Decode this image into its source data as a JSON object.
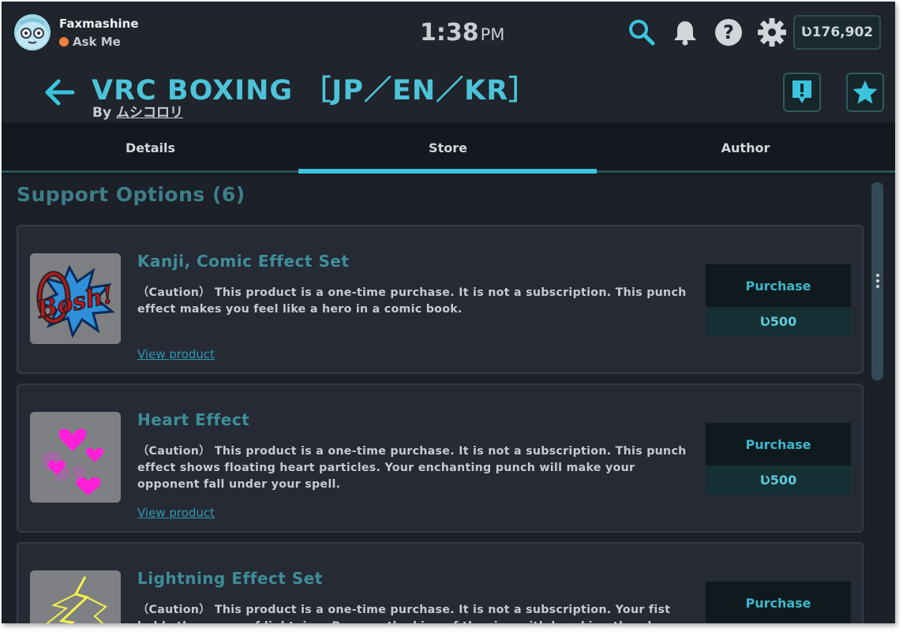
{
  "user": {
    "name": "Faxmashine",
    "status": "Ask Me"
  },
  "clock": {
    "time": "1:38",
    "ampm": "PM"
  },
  "balance": "Ʋ176,902",
  "world": {
    "title": "VRC BOXING ［JP／EN／KR］",
    "by": "By",
    "author": "ムシコロリ"
  },
  "tabs": [
    "Details",
    "Store",
    "Author"
  ],
  "active_tab": "Store",
  "section_title": "Support Options (6)",
  "products": [
    {
      "name": "Kanji, Comic Effect Set",
      "description": "（Caution） This product is a one-time purchase. It is not a subscription. This punch effect makes you feel like a hero in a comic book.",
      "thumb_text": "Bosh!",
      "link": "View product",
      "button": "Purchase",
      "price": "Ʋ500"
    },
    {
      "name": "Heart Effect",
      "description": "（Caution） This product is a one-time purchase. It is not a subscription. This punch effect shows floating heart particles. Your enchanting punch will make your opponent fall under your spell.",
      "link": "View product",
      "button": "Purchase",
      "price": "Ʋ500"
    },
    {
      "name": "Lightning Effect Set",
      "description": "（Caution） This product is a one-time purchase. It is not a subscription. Your fist holds the power of lightning. Become the king of the ring with breaking thunder.",
      "button": "Purchase"
    }
  ],
  "colors": {
    "accent": "#3ac3dd",
    "title": "#4dc3d8",
    "background": "#1c2029",
    "status_dot": "#f0803c"
  }
}
